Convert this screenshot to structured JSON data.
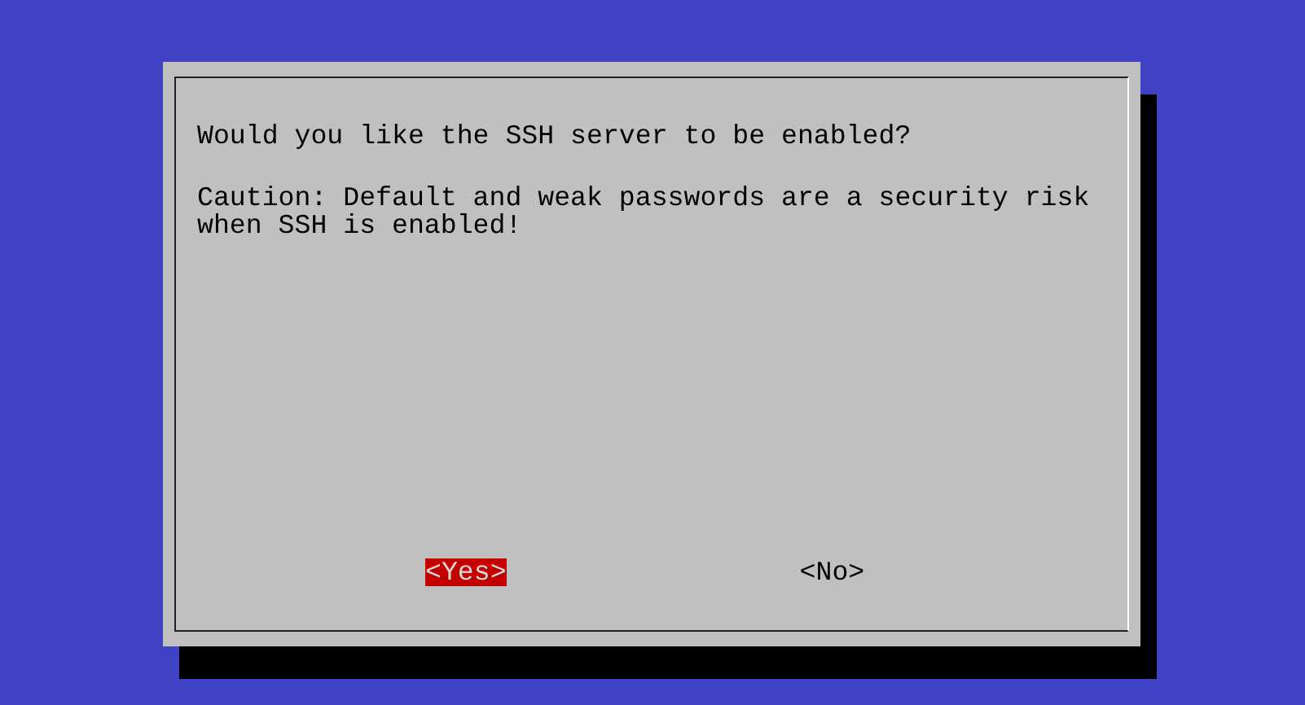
{
  "dialog": {
    "question": "Would you like the SSH server to be enabled?",
    "message": "Caution: Default and weak passwords are a security risk\nwhen SSH is enabled!"
  },
  "buttons": [
    {
      "label": "<Yes>",
      "selected": true
    },
    {
      "label": "<No>",
      "selected": false
    }
  ]
}
